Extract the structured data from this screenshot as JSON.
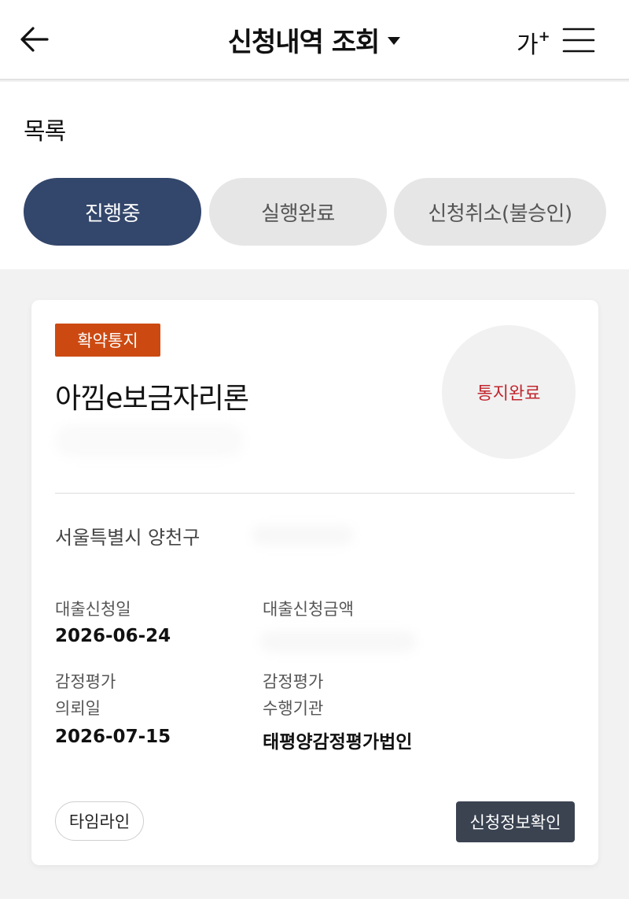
{
  "header": {
    "title": "신청내역 조회",
    "font_size_label": "가",
    "font_size_plus": "+",
    "icons": {
      "back": "arrow-left-icon",
      "title_caret": "caret-down-icon",
      "menu": "hamburger-menu-icon"
    }
  },
  "list": {
    "title": "목록",
    "tabs": [
      {
        "label": "진행중",
        "active": true
      },
      {
        "label": "실행완료",
        "active": false
      },
      {
        "label": "신청취소(불승인)",
        "active": false
      }
    ]
  },
  "card": {
    "badge": "확약통지",
    "product_name": "아낌e보금자리론",
    "status": "통지완료",
    "address": "서울특별시 양천구",
    "loan_date_label": "대출신청일",
    "loan_date": "2026-06-24",
    "loan_amount_label": "대출신청금액",
    "appraisal_request_label_1": "감정평가",
    "appraisal_request_label_2": "의뢰일",
    "appraisal_request_date": "2026-07-15",
    "appraisal_agency_label_1": "감정평가",
    "appraisal_agency_label_2": "수행기관",
    "appraisal_agency": "태평양감정평가법인",
    "timeline_button": "타임라인",
    "info_button": "신청정보확인"
  },
  "colors": {
    "active_tab": "#33466b",
    "badge": "#cc4a12",
    "status_text": "#c2262e",
    "info_button": "#3b4351"
  }
}
